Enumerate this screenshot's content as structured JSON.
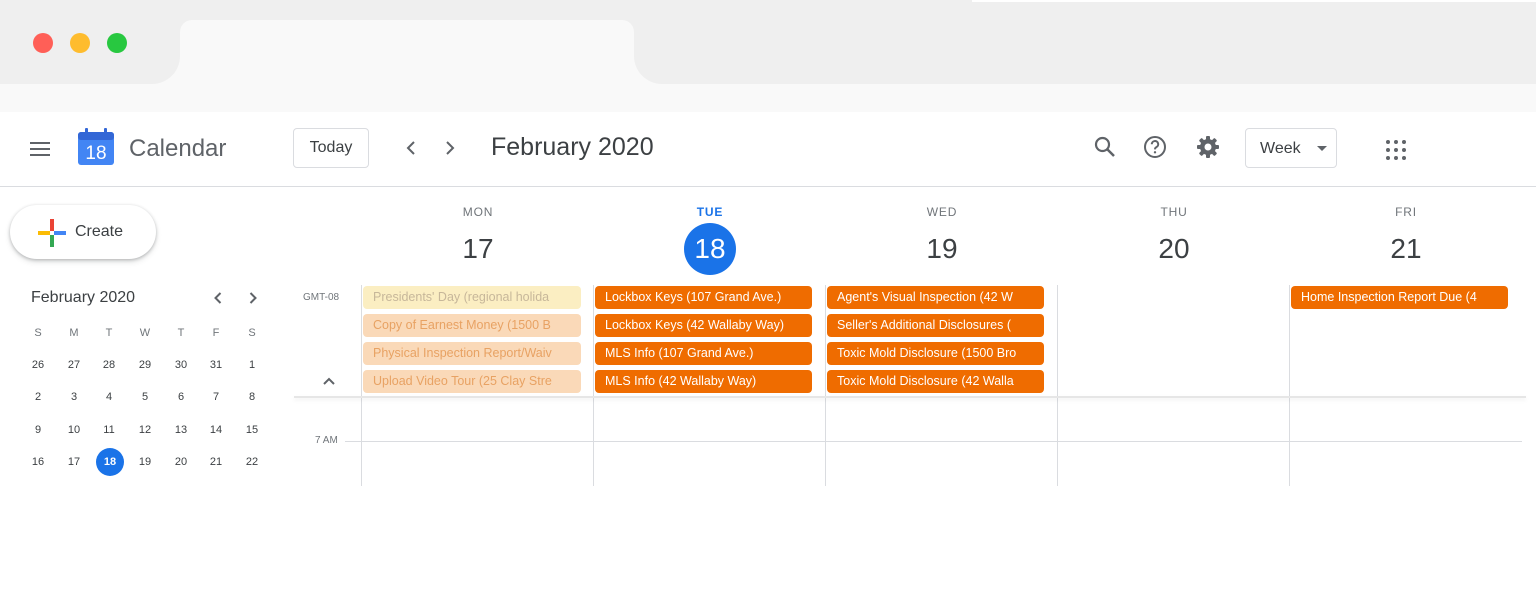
{
  "browser": {
    "traffic_lights": {
      "close": "#ff5f57",
      "minimize": "#febc2e",
      "zoom": "#28c840"
    }
  },
  "header": {
    "app_name": "Calendar",
    "logo_day": "18",
    "today_label": "Today",
    "month_title": "February 2020",
    "view_select": "Week",
    "icons": [
      "menu-icon",
      "chevron-left-icon",
      "chevron-right-icon",
      "search-icon",
      "help-icon",
      "settings-icon",
      "apps-icon"
    ]
  },
  "sidebar": {
    "create_label": "Create",
    "mini_calendar": {
      "title": "February 2020",
      "weekdays": [
        "S",
        "M",
        "T",
        "W",
        "T",
        "F",
        "S"
      ],
      "weeks": [
        [
          "26",
          "27",
          "28",
          "29",
          "30",
          "31",
          "1"
        ],
        [
          "2",
          "3",
          "4",
          "5",
          "6",
          "7",
          "8"
        ],
        [
          "9",
          "10",
          "11",
          "12",
          "13",
          "14",
          "15"
        ],
        [
          "16",
          "17",
          "18",
          "19",
          "20",
          "21",
          "22"
        ]
      ],
      "selected_day": "18"
    }
  },
  "week": {
    "timezone": "GMT-08",
    "time_label": "7 AM",
    "days": [
      {
        "dow": "MON",
        "num": "17",
        "today": false
      },
      {
        "dow": "TUE",
        "num": "18",
        "today": true
      },
      {
        "dow": "WED",
        "num": "19",
        "today": false
      },
      {
        "dow": "THU",
        "num": "20",
        "today": false
      },
      {
        "dow": "FRI",
        "num": "21",
        "today": false
      }
    ],
    "events": {
      "mon": [
        "Presidents' Day (regional holida",
        "Copy of Earnest Money (1500 B",
        "Physical Inspection Report/Waiv",
        "Upload Video Tour (25 Clay Stre"
      ],
      "tue": [
        "Lockbox Keys (107 Grand Ave.)",
        "Lockbox Keys (42 Wallaby Way)",
        "MLS Info (107 Grand Ave.)",
        "MLS Info (42 Wallaby Way)"
      ],
      "wed": [
        "Agent's Visual Inspection (42 W",
        "Seller's Additional Disclosures (",
        "Toxic Mold Disclosure (1500 Bro",
        "Toxic Mold Disclosure (42 Walla"
      ],
      "fri": [
        "Home Inspection Report Due (4"
      ]
    }
  },
  "colors": {
    "accent": "#1a73e8",
    "event_orange": "#ef6c00",
    "event_past_orange": "#fad9b8",
    "event_holiday": "#fbeec2"
  }
}
